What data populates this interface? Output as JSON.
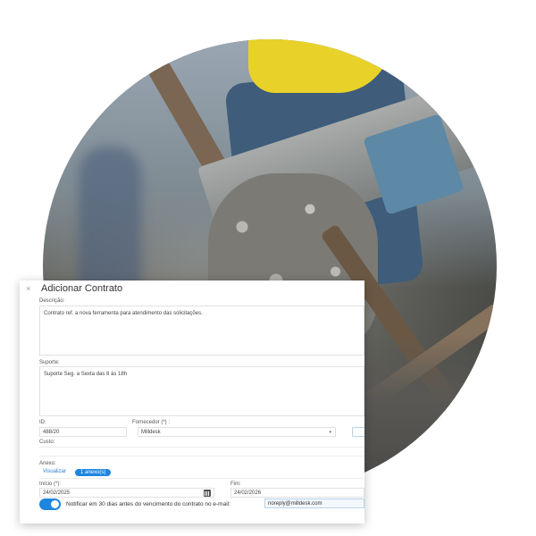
{
  "dialog": {
    "close_glyph": "×",
    "title": "Adicionar Contrato",
    "descricao": {
      "label": "Descrição:",
      "value": "Contrato ref. a nova ferramenta para atendimento das solicitações."
    },
    "suporte": {
      "label": "Suporte:",
      "value": "Suporte Seg. a Sexta das 8 às 18h"
    },
    "id": {
      "label": "ID:",
      "value": "488/20"
    },
    "fornecedor": {
      "label": "Fornecedor (*) :",
      "value": "Milldesk"
    },
    "custo": {
      "label": "Custo:"
    },
    "anexo": {
      "label": "Anexo:",
      "view_link": "Visualizar",
      "count_badge": "1 anexo(s)"
    },
    "inicio": {
      "label": "Início (*):",
      "value": "24/02/2025"
    },
    "fim": {
      "label": "Fim:",
      "value": "24/02/2026"
    },
    "notificar": {
      "text": "Notificar em 30 dias antes do vencimento do contrato no e-mail:",
      "enabled": true,
      "email": "noreply@milldesk.com"
    }
  },
  "colors": {
    "accent": "#1f86e0",
    "link": "#2d7fcf",
    "background": "#ffffff"
  }
}
